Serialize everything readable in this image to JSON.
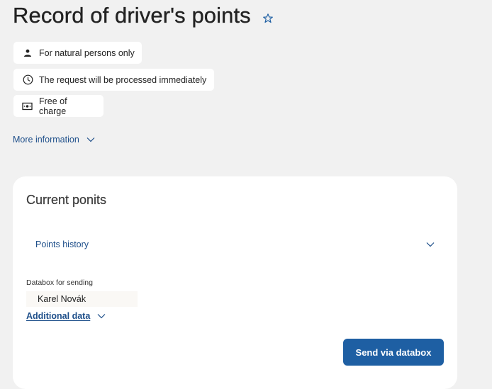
{
  "page": {
    "title": "Record of driver's points"
  },
  "tags": [
    {
      "icon": "person-icon",
      "label": "For natural persons only"
    },
    {
      "icon": "clock-icon",
      "label": "The request will be processed immediately"
    },
    {
      "icon": "money-icon",
      "label": "Free of charge"
    }
  ],
  "more_info": {
    "label": "More information"
  },
  "card": {
    "title": "Current ponits",
    "history_label": "Points history",
    "databox_label": "Databox for sending",
    "databox_value": "Karel Novák",
    "additional_label": "Additional data",
    "send_label": "Send via databox"
  },
  "colors": {
    "accent": "#1e5fa3",
    "link": "#1e4f8a",
    "background": "#f1f1f1"
  }
}
